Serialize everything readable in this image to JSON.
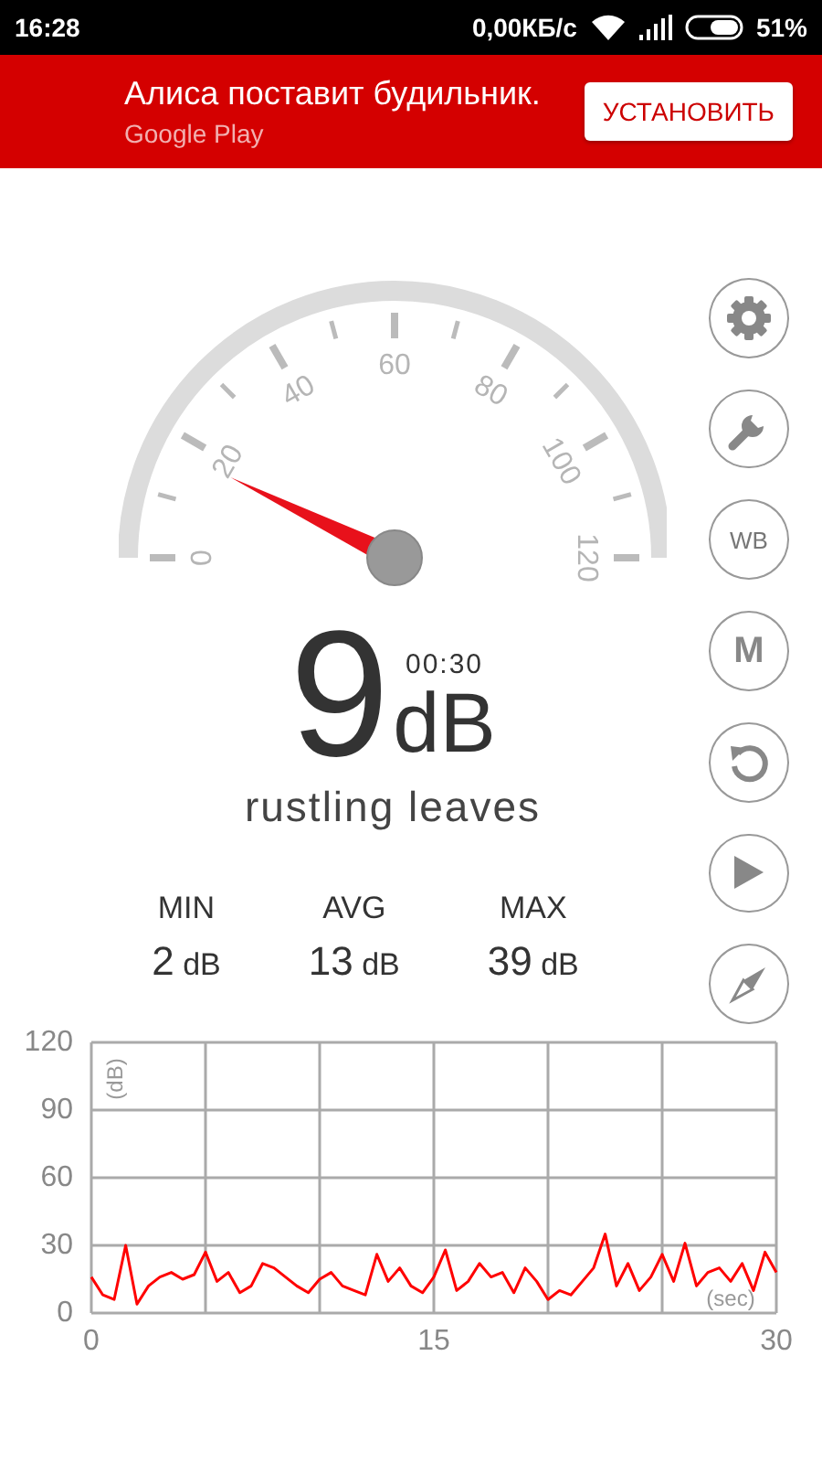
{
  "status_bar": {
    "time": "16:28",
    "speed": "0,00КБ/с",
    "battery": "51%"
  },
  "ad_banner": {
    "title": "Алиса поставит будильник.",
    "source": "Google Play",
    "button": "УСТАНОВИТЬ"
  },
  "gauge": {
    "labels": [
      "0",
      "20",
      "40",
      "60",
      "80",
      "100",
      "120"
    ]
  },
  "readout": {
    "value": "9",
    "unit": "dB",
    "timer": "00:30",
    "description": "rustling leaves"
  },
  "stats": [
    {
      "label": "MIN",
      "value": "2",
      "unit": "dB"
    },
    {
      "label": "AVG",
      "value": "13",
      "unit": "dB"
    },
    {
      "label": "MAX",
      "value": "39",
      "unit": "dB"
    }
  ],
  "side_buttons": [
    {
      "kind": "gear"
    },
    {
      "kind": "wrench"
    },
    {
      "kind": "text",
      "label": "$^{W}$$_{B}$"
    },
    {
      "kind": "text",
      "label": "M"
    },
    {
      "kind": "reset"
    },
    {
      "kind": "play"
    },
    {
      "kind": "compass"
    }
  ],
  "chart": {
    "chart_data": {
      "type": "line",
      "xlabel": "(sec)",
      "ylabel": "(dB)",
      "xlim": [
        0,
        30
      ],
      "ylim": [
        0,
        120
      ],
      "xticks": [
        0,
        15,
        30
      ],
      "yticks": [
        0,
        30,
        60,
        90,
        120
      ],
      "grid": true,
      "x": [
        0,
        0.5,
        1,
        1.5,
        2,
        2.5,
        3,
        3.5,
        4,
        4.5,
        5,
        5.5,
        6,
        6.5,
        7,
        7.5,
        8,
        8.5,
        9,
        9.5,
        10,
        10.5,
        11,
        11.5,
        12,
        12.5,
        13,
        13.5,
        14,
        14.5,
        15,
        15.5,
        16,
        16.5,
        17,
        17.5,
        18,
        18.5,
        19,
        19.5,
        20,
        20.5,
        21,
        21.5,
        22,
        22.5,
        23,
        23.5,
        24,
        24.5,
        25,
        25.5,
        26,
        26.5,
        27,
        27.5,
        28,
        28.5,
        29,
        29.5,
        30
      ],
      "series": [
        {
          "color": "#ff0000",
          "values": [
            16,
            8,
            6,
            30,
            4,
            12,
            16,
            18,
            15,
            17,
            27,
            14,
            18,
            9,
            12,
            22,
            20,
            16,
            12,
            9,
            15,
            18,
            12,
            10,
            8,
            26,
            14,
            20,
            12,
            9,
            16,
            28,
            10,
            14,
            22,
            16,
            18,
            9,
            20,
            14,
            6,
            10,
            8,
            14,
            20,
            35,
            12,
            22,
            10,
            16,
            26,
            14,
            31,
            12,
            18,
            20,
            14,
            22,
            10,
            27,
            18
          ]
        }
      ]
    }
  }
}
